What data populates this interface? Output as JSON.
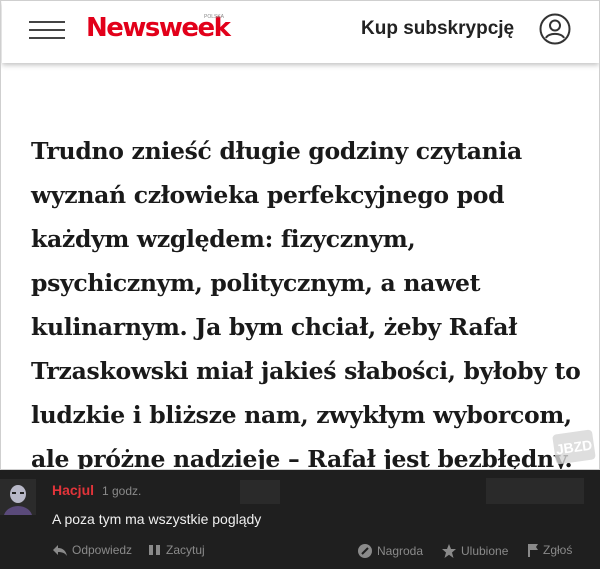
{
  "header": {
    "logo_text": "Newsweek",
    "logo_sub": "POLSKA",
    "subscribe_label": "Kup subskrypcję",
    "colors": {
      "logo_red": "#e2001a",
      "text": "#222222"
    },
    "icons": [
      "hamburger-icon",
      "user-icon"
    ]
  },
  "article": {
    "lines": [
      "Trudno znieść długie godziny czytania",
      "wyznań człowieka perfekcyjnego pod",
      "każdym względem: fizycznym,",
      "psychicznym, politycznym, a nawet",
      "kulinarnym. Ja bym chciał, żeby Rafał",
      "Trzaskowski miał jakieś słabości, byłoby to",
      "ludzkie i bliższe nam, zwykłym wyborcom,",
      "ale próżne nadzieje – Rafał jest bezbłędny."
    ],
    "watermark": "JBZD"
  },
  "comment": {
    "username": "Hacjul",
    "time": "1 godz.",
    "text": "A poza tym ma wszystkie poglądy",
    "actions": {
      "reply": "Odpowiedz",
      "quote": "Zacytuj",
      "award": "Nagroda",
      "favorite": "Ulubione",
      "report": "Zgłoś"
    },
    "colors": {
      "background": "#1f1f1f",
      "username": "#e2343a",
      "muted": "#8a8a8a"
    }
  }
}
